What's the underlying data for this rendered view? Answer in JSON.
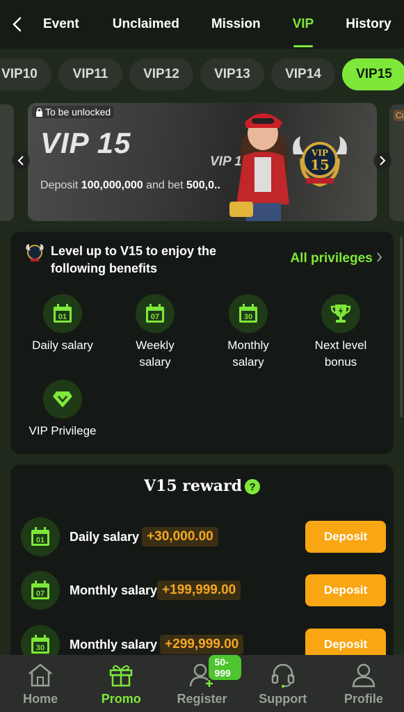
{
  "topnav": {
    "tabs": [
      {
        "label": "Event"
      },
      {
        "label": "Unclaimed"
      },
      {
        "label": "Mission"
      },
      {
        "label": "VIP"
      },
      {
        "label": "History"
      }
    ],
    "active_tab": "VIP"
  },
  "vip_levels": [
    "VIP10",
    "VIP11",
    "VIP12",
    "VIP13",
    "VIP14",
    "VIP15"
  ],
  "active_level": "VIP15",
  "banner": {
    "lock_text": "To be unlocked",
    "title": "VIP 15",
    "subtitle": "VIP 15",
    "badge_text": "15",
    "desc_prefix": "Deposit ",
    "desc_deposit": "100,000,000",
    "desc_mid": " and bet ",
    "desc_bet": "500,0..",
    "side_tag": "Cu"
  },
  "benefits": {
    "title": "Level up to V15 to enjoy the following benefits",
    "all_privileges": "All privileges",
    "items": [
      {
        "label": "Daily salary",
        "icon_text": "01",
        "icon": "calendar-icon"
      },
      {
        "label": "Weekly salary",
        "icon_text": "07",
        "icon": "calendar-icon"
      },
      {
        "label": "Monthly salary",
        "icon_text": "30",
        "icon": "calendar-icon"
      },
      {
        "label": "Next level bonus",
        "icon": "trophy-icon"
      },
      {
        "label": "VIP Privilege",
        "icon": "diamond-icon"
      }
    ]
  },
  "reward": {
    "title": "V15 reward",
    "help": "?",
    "rows": [
      {
        "icon_text": "01",
        "label": "Daily salary",
        "amount": "+30,000.00",
        "button": "Deposit"
      },
      {
        "icon_text": "07",
        "label": "Monthly salary",
        "amount": "+199,999.00",
        "button": "Deposit"
      },
      {
        "icon_text": "30",
        "label": "Monthly salary",
        "amount": "+299,999.00",
        "button": "Deposit"
      }
    ]
  },
  "bottomnav": {
    "items": [
      {
        "label": "Home"
      },
      {
        "label": "Promo"
      },
      {
        "label": "Register",
        "badge": "50-999"
      },
      {
        "label": "Support"
      },
      {
        "label": "Profile"
      }
    ],
    "active": "Promo"
  },
  "colors": {
    "accent": "#7ee83a",
    "deposit": "#f8a614",
    "amount": "#f5a623"
  }
}
